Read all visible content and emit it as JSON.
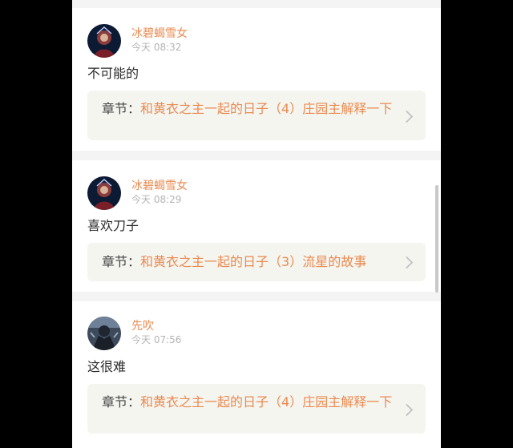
{
  "comments": [
    {
      "username": "冰碧蝎雪女",
      "time": "今天 08:32",
      "content": "不可能的",
      "chapter_prefix": "章节：",
      "chapter_title": "和黄衣之主一起的日子（4）庄园主解释一下"
    },
    {
      "username": "冰碧蝎雪女",
      "time": "今天 08:29",
      "content": "喜欢刀子",
      "chapter_prefix": "章节：",
      "chapter_title": "和黄衣之主一起的日子（3）流星的故事"
    },
    {
      "username": "先吹",
      "time": "今天 07:56",
      "content": "这很难",
      "chapter_prefix": "章节：",
      "chapter_title": "和黄衣之主一起的日子（4）庄园主解释一下"
    }
  ],
  "colors": {
    "accent": "#e98a50",
    "chapter_bg": "#f5f5f0"
  },
  "icons": [
    "avatar-blue-girl",
    "avatar-dark-figure",
    "chevron-right-icon"
  ]
}
